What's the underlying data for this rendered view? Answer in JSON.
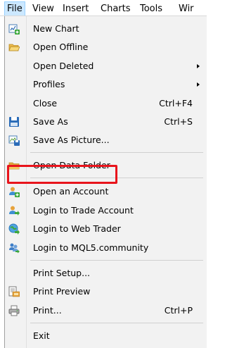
{
  "menubar": {
    "items": [
      "File",
      "View",
      "Insert",
      "Charts",
      "Tools",
      "Wir"
    ]
  },
  "menu": {
    "items": [
      {
        "label": "New Chart",
        "icon": "new-chart-icon"
      },
      {
        "label": "Open Offline",
        "icon": "open-folder-icon"
      },
      {
        "label": "Open Deleted",
        "submenu": true
      },
      {
        "label": "Profiles",
        "submenu": true
      },
      {
        "label": "Close",
        "shortcut": "Ctrl+F4"
      },
      {
        "label": "Save As",
        "shortcut": "Ctrl+S",
        "icon": "save-icon"
      },
      {
        "label": "Save As Picture...",
        "icon": "save-picture-icon"
      },
      {
        "label": "Open Data Folder",
        "icon": "data-folder-icon"
      },
      {
        "label": "Open an Account",
        "icon": "open-account-icon",
        "highlighted": true
      },
      {
        "label": "Login to Trade Account",
        "icon": "login-trade-icon"
      },
      {
        "label": "Login to Web Trader",
        "icon": "web-trader-icon"
      },
      {
        "label": "Login to MQL5.community",
        "icon": "mql5-community-icon"
      },
      {
        "label": "Print Setup..."
      },
      {
        "label": "Print Preview",
        "icon": "print-preview-icon"
      },
      {
        "label": "Print...",
        "shortcut": "Ctrl+P",
        "icon": "printer-icon"
      },
      {
        "label": "Exit"
      }
    ]
  },
  "colors": {
    "highlight_border": "#e8141c",
    "menu_background": "#f2f2f2",
    "active_menubar": "#cce8ff"
  }
}
